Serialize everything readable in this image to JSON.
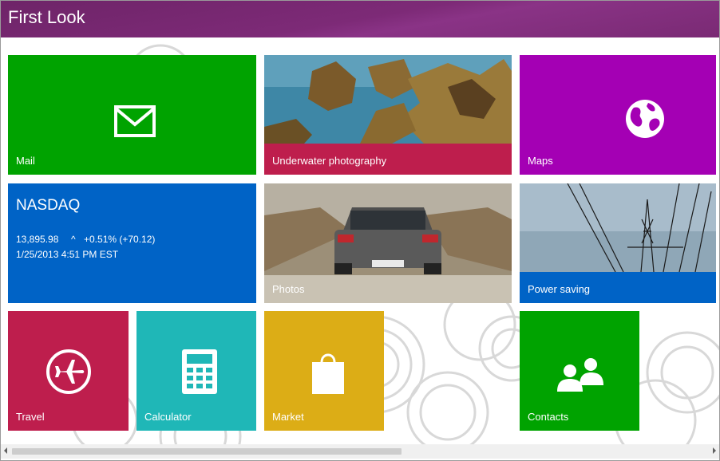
{
  "window": {
    "title": "First Look"
  },
  "tiles": {
    "mail": {
      "label": "Mail",
      "color": "#00a300",
      "icon": "mail-icon"
    },
    "underwater": {
      "label": "Underwater photography",
      "color": "#be1e4d",
      "icon": "photo-rocks"
    },
    "maps": {
      "label": "Maps",
      "color": "#a400b4",
      "icon": "globe-icon"
    },
    "nasdaq": {
      "label": "NASDAQ",
      "color": "#0063c6",
      "value": "13,895.98",
      "arrow": "^",
      "change": "+0.51% (+70.12)",
      "timestamp": "1/25/2013 4:51 PM EST"
    },
    "photos": {
      "label": "Photos",
      "icon": "photo-car"
    },
    "power": {
      "label": "Power saving",
      "color": "#0063c6",
      "icon": "photo-powerline"
    },
    "travel": {
      "label": "Travel",
      "color": "#be1e4d",
      "icon": "airplane-icon"
    },
    "calculator": {
      "label": "Calculator",
      "color": "#1fb7b7",
      "icon": "calculator-icon"
    },
    "market": {
      "label": "Market",
      "color": "#dcad16",
      "icon": "shopping-bag-icon"
    },
    "contacts": {
      "label": "Contacts",
      "color": "#00a300",
      "icon": "people-icon"
    }
  },
  "scrollbar": {
    "position": 0.0
  }
}
